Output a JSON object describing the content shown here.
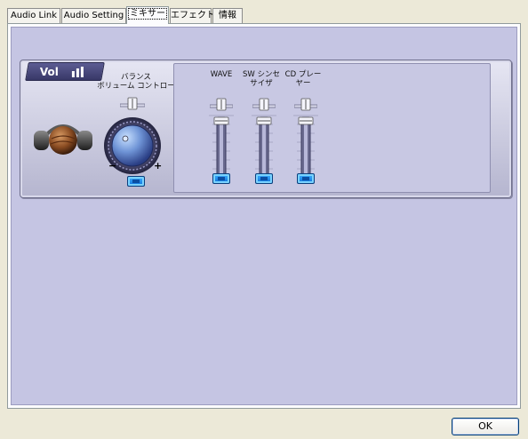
{
  "tabs": [
    {
      "label": "Audio Link"
    },
    {
      "label": "Audio Setting"
    },
    {
      "label": "ミキサー",
      "active": true
    },
    {
      "label": "エフェクト"
    },
    {
      "label": "情報"
    }
  ],
  "mixer": {
    "vol_tab_label": "Vol",
    "master_label_line1": "バランス",
    "master_label_line2": "ボリューム コントロー",
    "knob_minus": "−",
    "knob_plus": "+",
    "channels": [
      {
        "label_line1": "WAVE",
        "label_line2": "",
        "mute_icon": "mute-button-icon"
      },
      {
        "label_line1": "SW シンセ",
        "label_line2": "サイザ",
        "mute_icon": "mute-button-icon"
      },
      {
        "label_line1": "CD プレー",
        "label_line2": "ヤー",
        "mute_icon": "mute-button-icon"
      }
    ]
  },
  "footer": {
    "ok_label": "OK"
  },
  "colors": {
    "mixer_background": "#c5c5e3",
    "vol_tab": "#4a4a7e",
    "mute_button": "#2796f0"
  }
}
